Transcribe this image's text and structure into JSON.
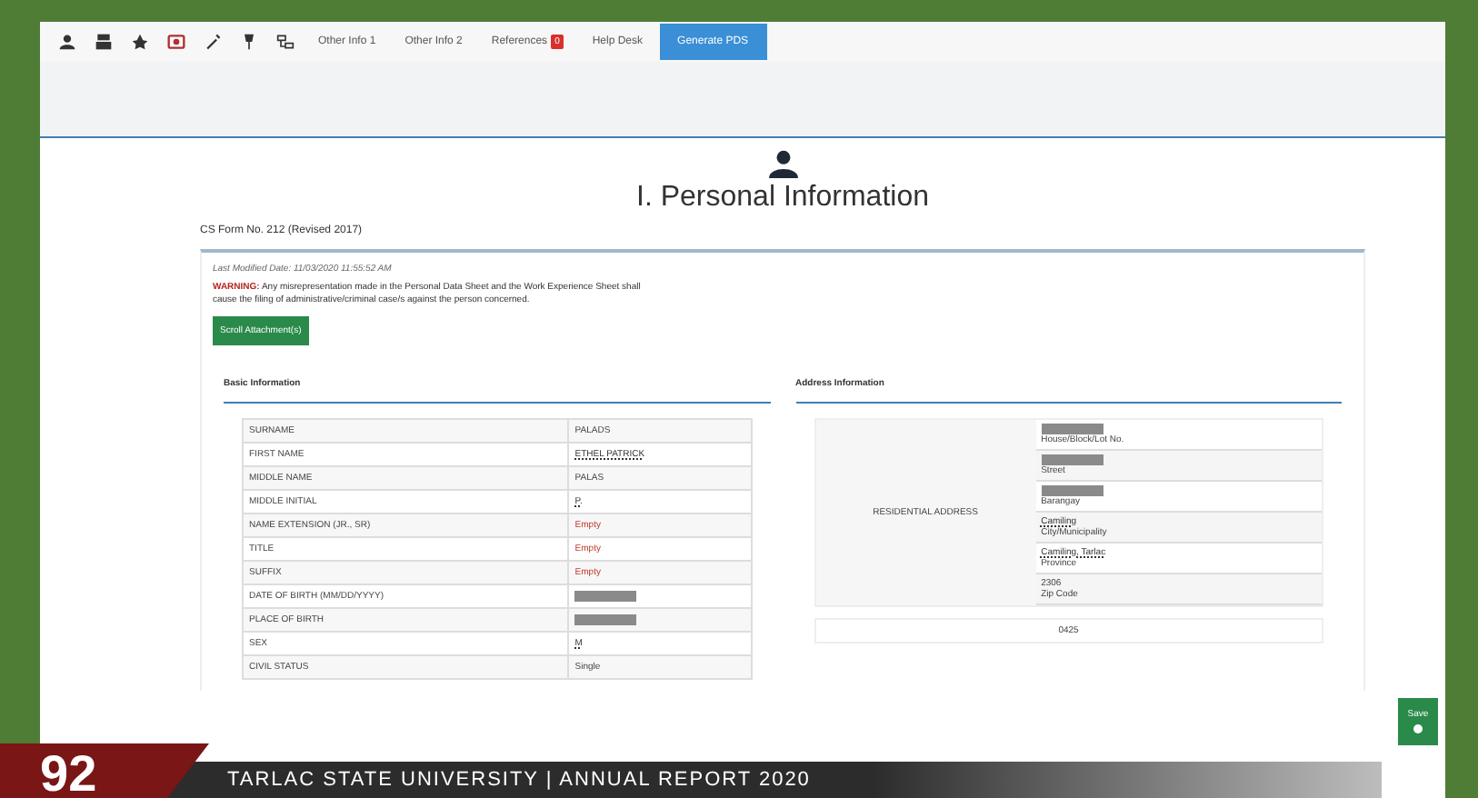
{
  "nav": {
    "links": [
      {
        "label": "Other Info 1"
      },
      {
        "label": "Other Info 2"
      },
      {
        "label": "References",
        "badge": "0"
      },
      {
        "label": "Help Desk"
      }
    ],
    "primary_button": "Generate PDS"
  },
  "page": {
    "title": "I. Personal Information",
    "form_label": "CS Form No. 212 (Revised 2017)",
    "last_modified": "Last Modified Date: 11/03/2020 11:55:52 AM",
    "warning_label": "WARNING:",
    "warning_text": "Any misrepresentation made in the Personal Data Sheet and the Work Experience Sheet shall",
    "warning_text_2": "cause the filing of administrative/criminal case/s against the person concerned.",
    "attachment_button": "Scroll Attachment(s)"
  },
  "basic_info": {
    "heading": "Basic Information",
    "rows": [
      {
        "label": "SURNAME",
        "value": "PALADS",
        "kind": "text"
      },
      {
        "label": "FIRST NAME",
        "value": "ETHEL PATRICK",
        "kind": "link"
      },
      {
        "label": "MIDDLE NAME",
        "value": "PALAS",
        "kind": "text"
      },
      {
        "label": "MIDDLE INITIAL",
        "value": "P.",
        "kind": "link"
      },
      {
        "label": "NAME EXTENSION (JR., SR)",
        "value": "Empty",
        "kind": "empty"
      },
      {
        "label": "TITLE",
        "value": "Empty",
        "kind": "empty"
      },
      {
        "label": "SUFFIX",
        "value": "Empty",
        "kind": "empty"
      },
      {
        "label": "DATE OF BIRTH (MM/DD/YYYY)",
        "kind": "redacted"
      },
      {
        "label": "PLACE OF BIRTH",
        "kind": "redacted"
      },
      {
        "label": "SEX",
        "value": "M",
        "kind": "link"
      },
      {
        "label": "CIVIL STATUS",
        "value": "Single",
        "kind": "text"
      }
    ]
  },
  "address_info": {
    "heading": "Address Information",
    "group_label": "RESIDENTIAL ADDRESS",
    "rows": [
      {
        "caption": "House/Block/Lot No.",
        "kind": "redacted"
      },
      {
        "caption": "Street",
        "kind": "redacted"
      },
      {
        "caption": "Barangay",
        "kind": "redacted"
      },
      {
        "value": "Camiling",
        "caption": "City/Municipality",
        "kind": "link"
      },
      {
        "value": "Camiling, Tarlac",
        "caption": "Province",
        "kind": "link"
      },
      {
        "value": "2306",
        "caption": "Zip Code",
        "kind": "text"
      }
    ],
    "next_value": "0425"
  },
  "save_button": "Save",
  "footer": {
    "page_number": "92",
    "text": "TARLAC STATE UNIVERSITY  |  ANNUAL REPORT 2020"
  }
}
